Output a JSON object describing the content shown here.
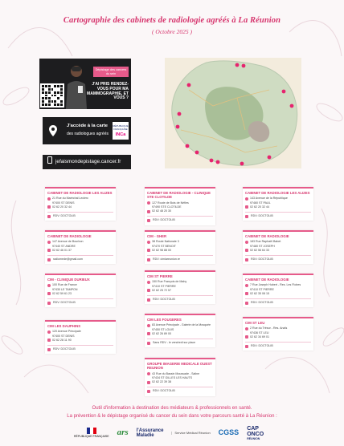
{
  "title": "Cartographie des cabinets de radiologie agréés à La Réunion",
  "subtitle": "( Octobre 2025 )",
  "promo": {
    "badge": "Dépistage des cancers du sein",
    "headline": "J'AI PRIS RENDEZ-VOUS POUR MA MAMMOGRAPHIE, ET VOUS ?"
  },
  "cta": {
    "line1": "J'accède à la carte",
    "line2": "des radiologues agréés",
    "inca_top": "RÉPUBLIQUE FRANÇAISE",
    "inca_logo": "INCa"
  },
  "website": "jefaismondepistage.cancer.fr",
  "colors": {
    "accent": "#d6336c",
    "card_border": "#e65a8a",
    "promo_bg": "#1d1d1f"
  },
  "cards": [
    {
      "name": "CABINET DE RADIOLOGIE LES ALIZES",
      "address": "21 Rue du Maréchal Leclerc",
      "city": "97400 ST DENIS",
      "phone": "02 62 20 32 44",
      "rdv": "RDV: DOCTOLIB"
    },
    {
      "name": "CABINET DE RADIOLOGIE - CLINIQUE STE CLOTILDE",
      "address": "127 Route de Bois de Nèfles",
      "city": "97490 STE CLOTILDE",
      "phone": "02 62 48 20 30",
      "rdv": "RDV: DOCTOLIB"
    },
    {
      "name": "CABINET DE RADIOLOGIE LES ALIZES",
      "address": "143 Avenue de la République",
      "city": "97460 ST PAUL",
      "phone": "02 62 20 32 44",
      "rdv": "RDV: DOCTOLIB"
    },
    {
      "name": "CABINET DE RADIOLOGIE",
      "address": "147 Avenue de Bourbon",
      "city": "97440 ST ANDRE",
      "phone": "02 62 46 01 37",
      "rdv": "radiomede@gmail.com"
    },
    {
      "name": "CIM - GHER",
      "address": "38 Route Nationale 3",
      "city": "97470 ST BENOIT",
      "phone": "02 62 98 88 00",
      "rdv": "RDV: cimlareunion.re"
    },
    {
      "name": "CABINET DE RADIOLOGIE",
      "address": "183 Rue Raphaël Babet",
      "city": "97480 ST JOSEPH",
      "phone": "02 62 56 64 33",
      "rdv": "RDV: DOCTOLIB"
    },
    {
      "name": "CIM - CLINIQUE DURIEUX",
      "address": "100 Rue de France",
      "city": "97430 LE TAMPON",
      "phone": "02 62 59 61 23",
      "rdv": "RDV: DOCTOLIB"
    },
    {
      "name": "CIM ST PIERRE",
      "address": "150 Rue François de Mahy",
      "city": "97410 ST PIERRE",
      "phone": "02 62 25 72 57",
      "rdv": "RDV: DOCTOLIB"
    },
    {
      "name": "CABINET DE RADIOLOGIE",
      "address": "7 Rue Joseph Hubert - Res. Les Flobes",
      "city": "97410 ST PIERRE",
      "phone": "02 62 35 08 15",
      "rdv": "RDV: DOCTOLIB"
    },
    {
      "name": "CIM LES DAUPHINS",
      "address": "120 Avenue Principale",
      "city": "97400 ST DENIS",
      "phone": "02 62 28 11 90",
      "rdv": "RDV: DOCTOLIB"
    },
    {
      "name": "CIM LES FOUGERES",
      "address": "83 Avenue Principale - Galerie de la Mosquée",
      "city": "97450 ST LOUIS",
      "phone": "02 62 26 89 00",
      "rdv": "Sans RDV - le vendredi sur place"
    },
    {
      "name": "CIM ST LEU",
      "address": "2 Rue du Trésor - Res. Anaïs",
      "city": "97436 ST LEU",
      "phone": "02 62 34 69 01",
      "rdv": "RDV: DOCTOLIB"
    },
    {
      "name": "GROUPE IMAGERIE MEDICALE OUEST REUNION",
      "address": "43 Rue du Bassin Moussade - Saline",
      "city": "97434 ST GILLES LES HAUTS",
      "phone": "02 62 22 39 38",
      "rdv": "RDV: DOCTOLIB"
    }
  ],
  "footer": {
    "line1": "Outil d'information à destination des médiateurs & professionnels en santé.",
    "line2": "La prévention & le dépistage organisé du cancer du sein dans votre parcours santé à La Réunion :"
  },
  "logos": {
    "rf": "RÉPUBLIQUE FRANÇAISE",
    "ars": "ars",
    "am_line1": "l'Assurance",
    "am_line2": "Maladie",
    "sm": "Service Médical Réunion",
    "cgss": "CGSS",
    "cap_line1": "CAP",
    "cap_line2": "ONCO",
    "cap_line3": "RÉUNION"
  }
}
